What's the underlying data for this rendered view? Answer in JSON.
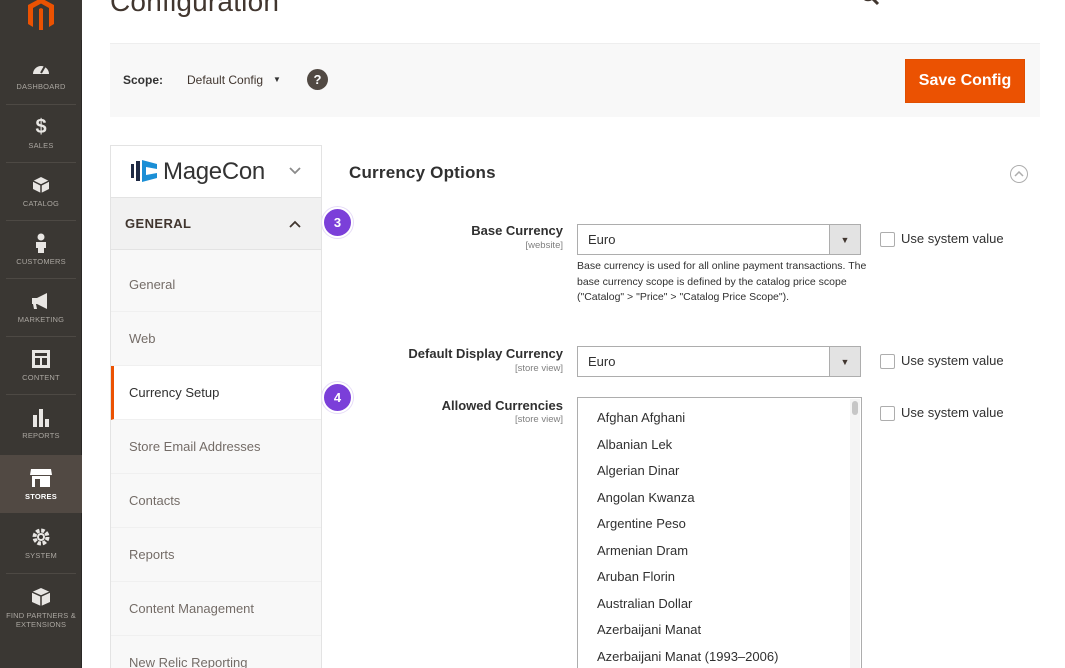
{
  "page": {
    "title": "Configuration"
  },
  "admin_menu": {
    "items": [
      {
        "label": "DASHBOARD",
        "icon": "dashboard-icon"
      },
      {
        "label": "SALES",
        "icon": "dollar-icon"
      },
      {
        "label": "CATALOG",
        "icon": "cube-icon"
      },
      {
        "label": "CUSTOMERS",
        "icon": "person-icon"
      },
      {
        "label": "MARKETING",
        "icon": "megaphone-icon"
      },
      {
        "label": "CONTENT",
        "icon": "content-icon"
      },
      {
        "label": "REPORTS",
        "icon": "bar-chart-icon"
      },
      {
        "label": "STORES",
        "icon": "store-icon"
      },
      {
        "label": "SYSTEM",
        "icon": "gear-icon"
      },
      {
        "label": "FIND PARTNERS & EXTENSIONS",
        "icon": "box-icon"
      }
    ],
    "active_label": "STORES"
  },
  "scope_bar": {
    "label": "Scope:",
    "value": "Default Config",
    "help": "?",
    "save_label": "Save Config"
  },
  "config_nav": {
    "brand": "MageCon",
    "section": "GENERAL",
    "items": [
      {
        "label": "General"
      },
      {
        "label": "Web"
      },
      {
        "label": "Currency Setup"
      },
      {
        "label": "Store Email Addresses"
      },
      {
        "label": "Contacts"
      },
      {
        "label": "Reports"
      },
      {
        "label": "Content Management"
      },
      {
        "label": "New Relic Reporting"
      }
    ],
    "active_label": "Currency Setup"
  },
  "badges": {
    "step3": "3",
    "step4": "4"
  },
  "currency_options": {
    "title": "Currency Options",
    "base_currency": {
      "label": "Base Currency",
      "scope": "[website]",
      "value": "Euro",
      "comment": "Base currency is used for all online payment transactions. The base currency scope is defined by the catalog price scope (\"Catalog\" > \"Price\" > \"Catalog Price Scope\").",
      "use_system_label": "Use system value"
    },
    "default_display_currency": {
      "label": "Default Display Currency",
      "scope": "[store view]",
      "value": "Euro",
      "use_system_label": "Use system value"
    },
    "allowed_currencies": {
      "label": "Allowed Currencies",
      "scope": "[store view]",
      "use_system_label": "Use system value",
      "options": [
        "Afghan Afghani",
        "Albanian Lek",
        "Algerian Dinar",
        "Angolan Kwanza",
        "Argentine Peso",
        "Armenian Dram",
        "Aruban Florin",
        "Australian Dollar",
        "Azerbaijani Manat",
        "Azerbaijani Manat (1993–2006)"
      ]
    }
  },
  "colors": {
    "accent": "#eb5202",
    "menu_bg": "#3a3733",
    "badge": "#7b3fd9"
  }
}
